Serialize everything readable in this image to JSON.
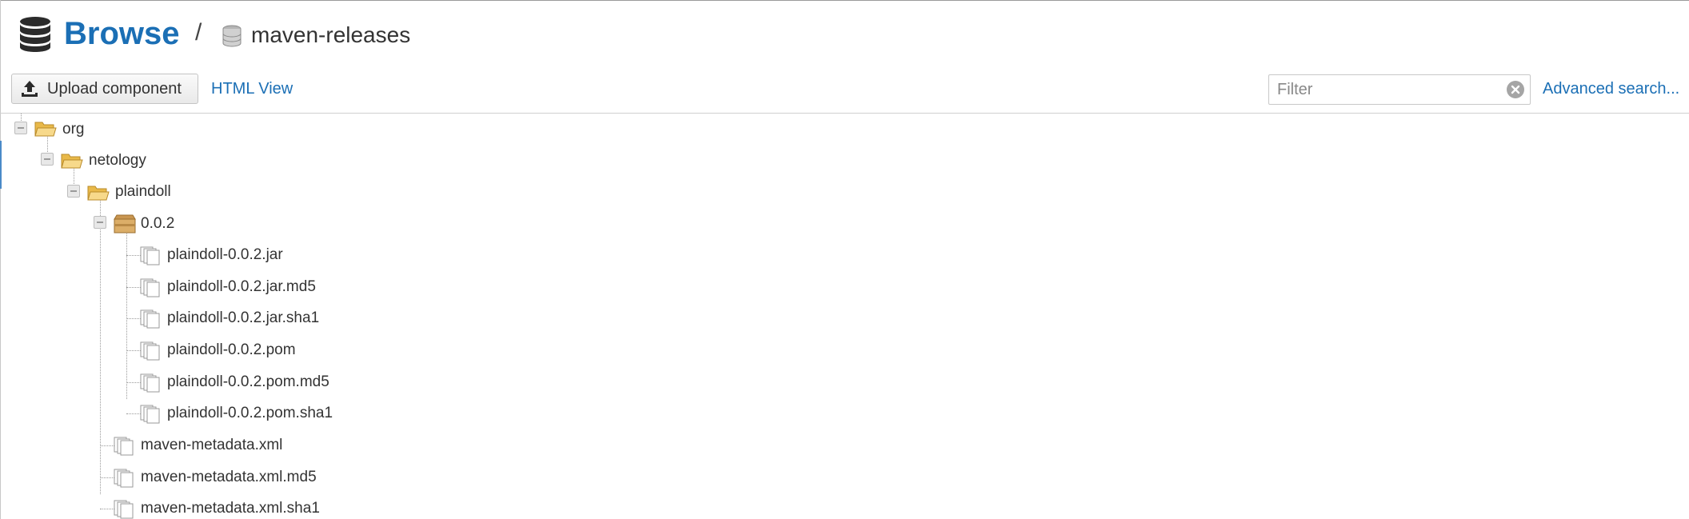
{
  "header": {
    "title": "Browse",
    "separator": "/",
    "repository": "maven-releases",
    "icons": {
      "browse": "database-icon",
      "repository": "repository-icon"
    }
  },
  "toolbar": {
    "upload_label": "Upload component",
    "upload_icon": "upload-icon",
    "html_view_label": "HTML View",
    "filter_placeholder": "Filter",
    "filter_value": "",
    "clear_icon": "clear-icon",
    "advanced_search_label": "Advanced search..."
  },
  "tree": {
    "org": {
      "label": "org",
      "icon": "folder-open-icon"
    },
    "netology": {
      "label": "netology",
      "icon": "folder-open-icon"
    },
    "plaindoll": {
      "label": "plaindoll",
      "icon": "folder-open-icon"
    },
    "version": {
      "label": "0.0.2",
      "icon": "component-icon"
    },
    "version_files": [
      {
        "label": "plaindoll-0.0.2.jar",
        "icon": "file-icon"
      },
      {
        "label": "plaindoll-0.0.2.jar.md5",
        "icon": "file-icon"
      },
      {
        "label": "plaindoll-0.0.2.jar.sha1",
        "icon": "file-icon"
      },
      {
        "label": "plaindoll-0.0.2.pom",
        "icon": "file-icon"
      },
      {
        "label": "plaindoll-0.0.2.pom.md5",
        "icon": "file-icon"
      },
      {
        "label": "plaindoll-0.0.2.pom.sha1",
        "icon": "file-icon"
      }
    ],
    "metadata_files": [
      {
        "label": "maven-metadata.xml",
        "icon": "file-icon"
      },
      {
        "label": "maven-metadata.xml.md5",
        "icon": "file-icon"
      },
      {
        "label": "maven-metadata.xml.sha1",
        "icon": "file-icon"
      }
    ]
  },
  "colors": {
    "accent": "#1b6fb5",
    "folder": "#f5d27a",
    "component": "#d6a765"
  }
}
